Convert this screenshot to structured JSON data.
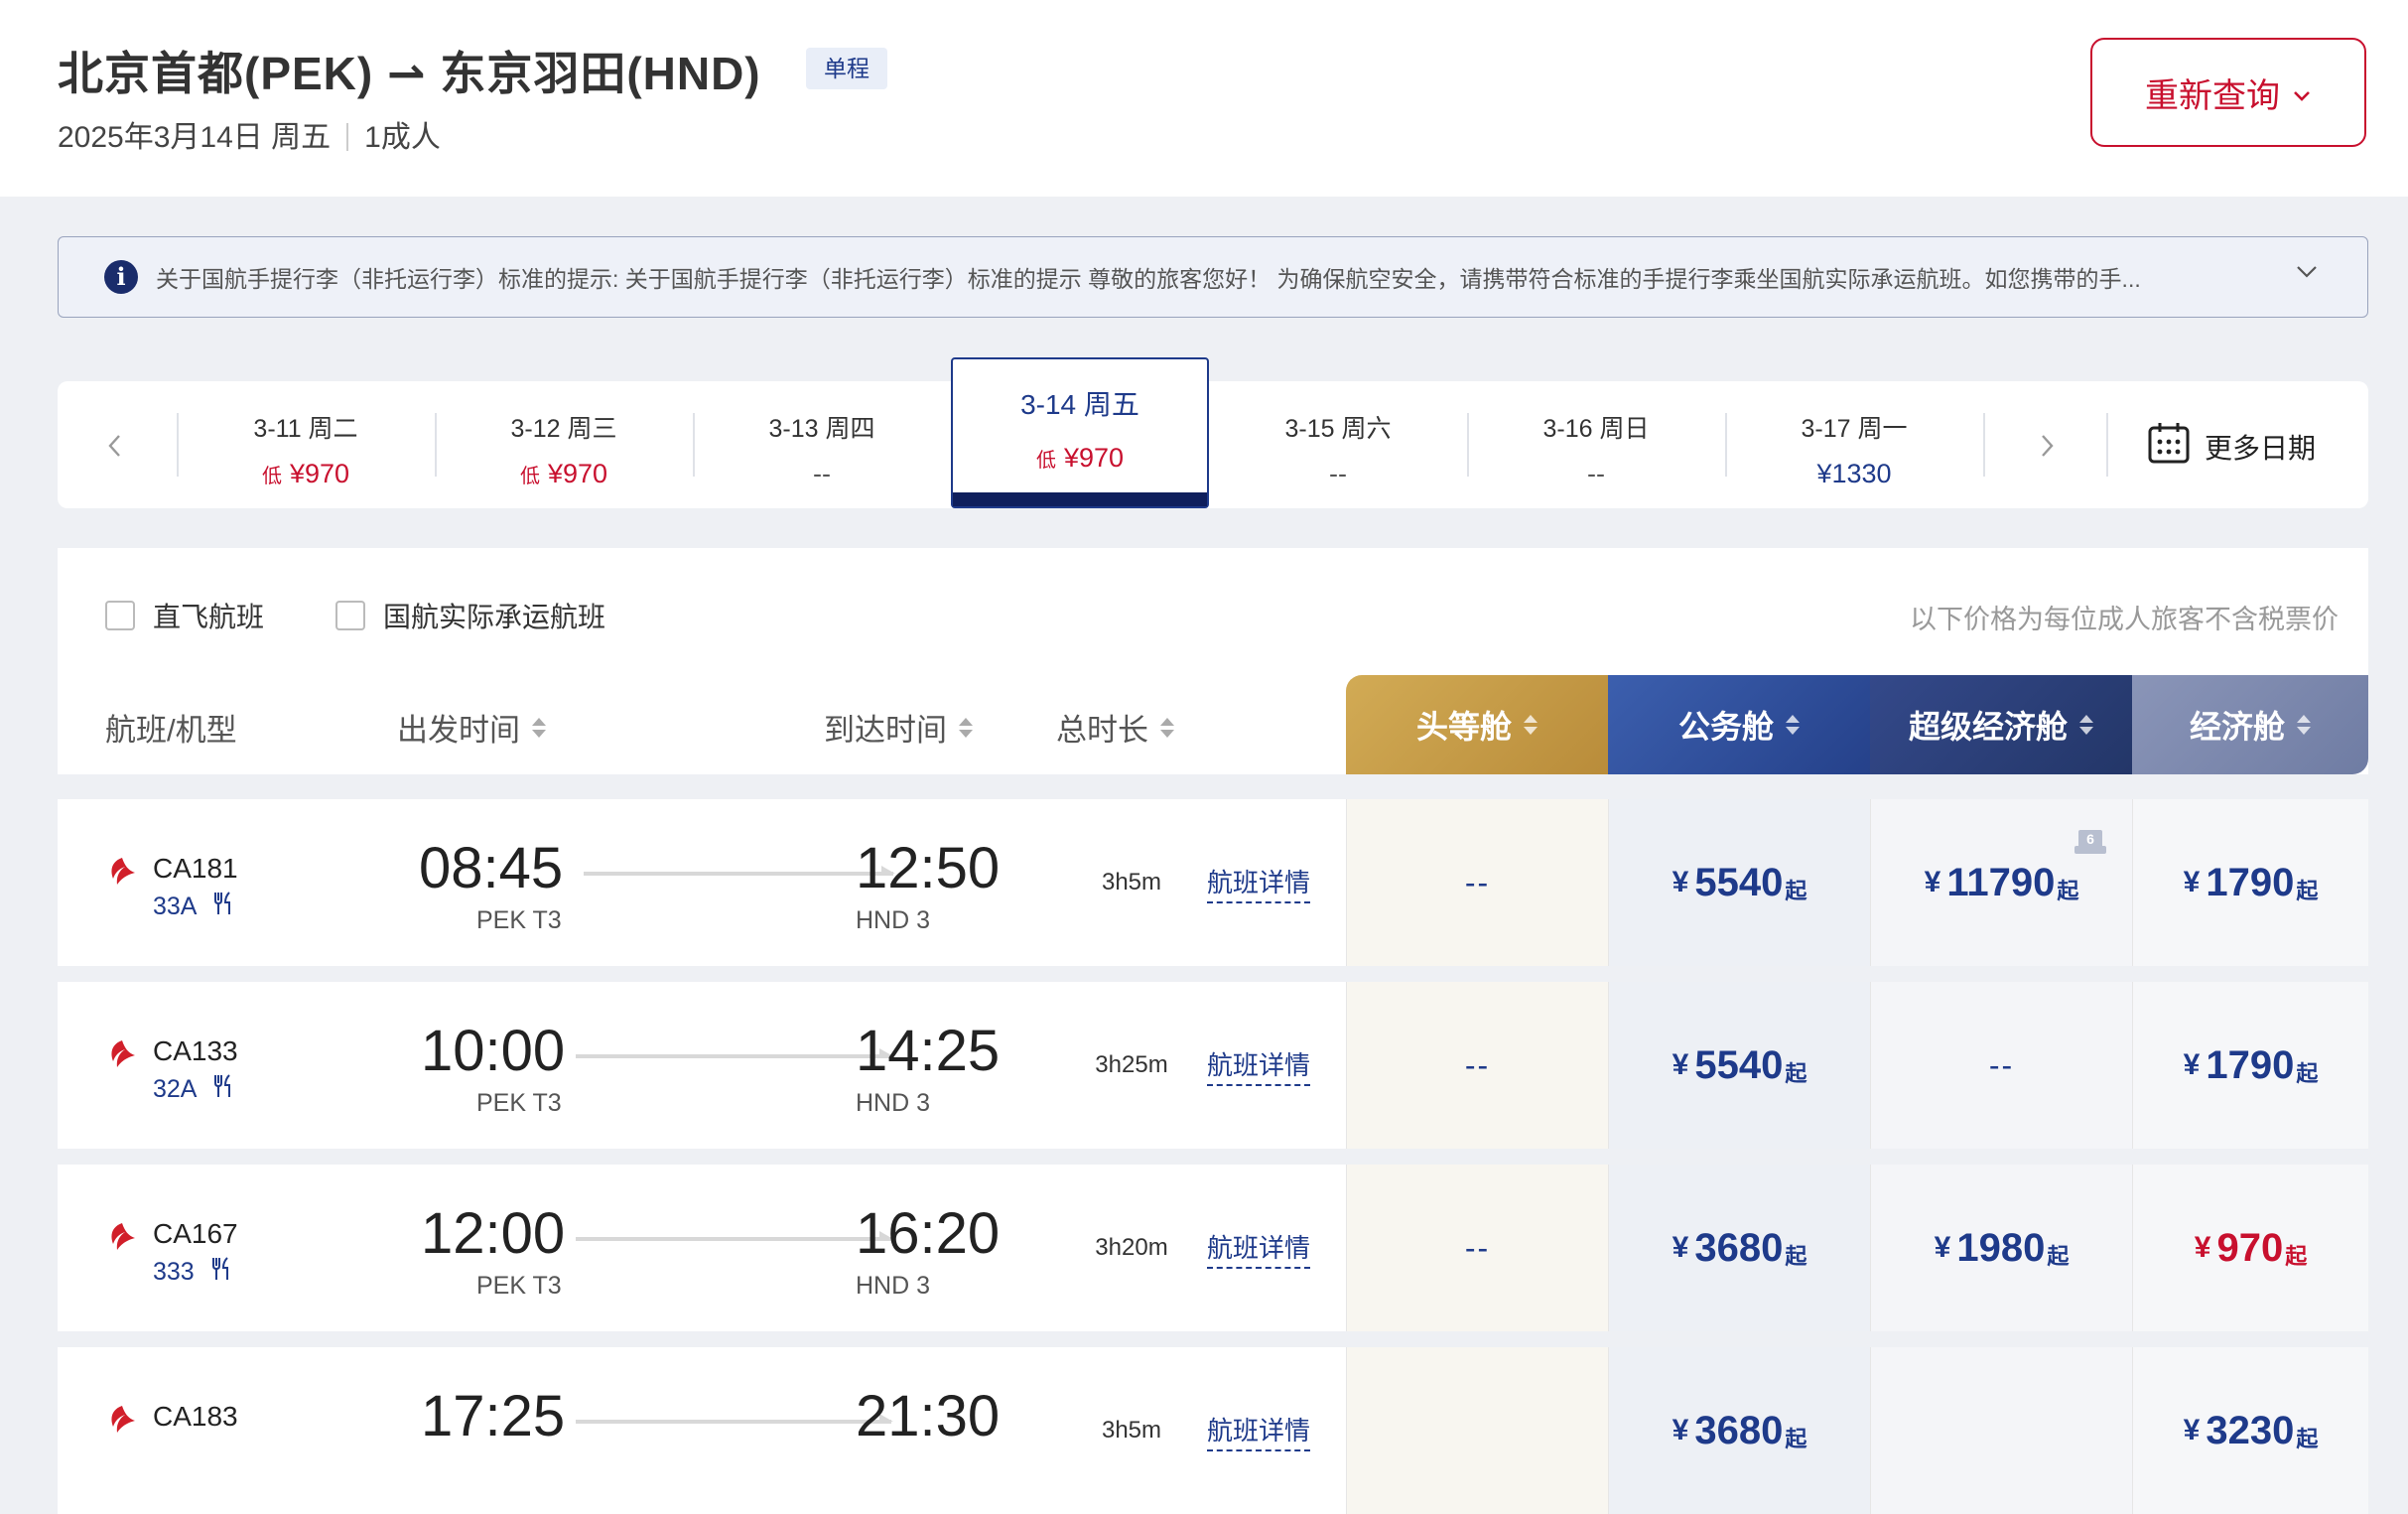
{
  "header": {
    "route": "北京首都(PEK) ⇀ 东京羽田(HND)",
    "trip_type": "单程",
    "date": "2025年3月14日 周五",
    "passengers": "1成人",
    "requery_label": "重新查询"
  },
  "notice": {
    "text": "关于国航手提行李（非托运行李）标准的提示:  关于国航手提行李（非托运行李）标准的提示 尊敬的旅客您好！ 为确保航空安全，请携带符合标准的手提行李乘坐国航实际承运航班。如您携带的手..."
  },
  "date_bar": {
    "dates": [
      {
        "label": "3-11 周二",
        "low": "低",
        "price": "¥970"
      },
      {
        "label": "3-12 周三",
        "low": "低",
        "price": "¥970"
      },
      {
        "label": "3-13 周四",
        "low": "",
        "price": "--"
      },
      {
        "label": "3-14 周五",
        "low": "低",
        "price": "¥970"
      },
      {
        "label": "3-15 周六",
        "low": "",
        "price": "--"
      },
      {
        "label": "3-16 周日",
        "low": "",
        "price": "--"
      },
      {
        "label": "3-17 周一",
        "low": "",
        "price": "¥1330"
      }
    ],
    "more_label": "更多日期"
  },
  "filters": {
    "nonstop": "直飞航班",
    "operated": "国航实际承运航班",
    "price_note": "以下价格为每位成人旅客不含税票价"
  },
  "columns": {
    "flight": "航班/机型",
    "depart": "出发时间",
    "arrive": "到达时间",
    "duration": "总时长",
    "first": "头等舱",
    "business": "公务舱",
    "premium": "超级经济舱",
    "economy": "经济舱"
  },
  "colors": {
    "brand_red": "#c8102e",
    "navy": "#1e3a8a",
    "first_gold": "#c9a14d",
    "business_blue": "#2f4e9a",
    "premium_navy": "#2a3f78",
    "economy_slate": "#7f8bae"
  },
  "flights": [
    {
      "no": "CA181",
      "craft": "33A",
      "dep": "08:45",
      "dep_apt": "PEK T3",
      "arr": "12:50",
      "arr_apt": "HND 3",
      "dur": "3h5m",
      "detail": "航班详情",
      "first": "--",
      "biz_cur": "¥",
      "biz": "5540",
      "biz_qi": "起",
      "sup_cur": "¥",
      "sup": "11790",
      "sup_qi": "起",
      "seats": "6",
      "eco_cur": "¥",
      "eco": "1790",
      "eco_qi": "起"
    },
    {
      "no": "CA133",
      "craft": "32A",
      "dep": "10:00",
      "dep_apt": "PEK T3",
      "arr": "14:25",
      "arr_apt": "HND 3",
      "dur": "3h25m",
      "detail": "航班详情",
      "first": "--",
      "biz_cur": "¥",
      "biz": "5540",
      "biz_qi": "起",
      "sup": "--",
      "eco_cur": "¥",
      "eco": "1790",
      "eco_qi": "起"
    },
    {
      "no": "CA167",
      "craft": "333",
      "dep": "12:00",
      "dep_apt": "PEK T3",
      "arr": "16:20",
      "arr_apt": "HND 3",
      "dur": "3h20m",
      "detail": "航班详情",
      "first": "--",
      "biz_cur": "¥",
      "biz": "3680",
      "biz_qi": "起",
      "sup_cur": "¥",
      "sup": "1980",
      "sup_qi": "起",
      "eco_cur": "¥",
      "eco": "970",
      "eco_qi": "起"
    },
    {
      "no": "CA183",
      "craft": "",
      "dep": "17:25",
      "dep_apt": "",
      "arr": "21:30",
      "arr_apt": "",
      "dur": "3h5m",
      "detail": "航班详情",
      "first": "",
      "biz_cur": "¥",
      "biz": "3680",
      "biz_qi": "起",
      "sup": "",
      "eco_cur": "¥",
      "eco": "3230",
      "eco_qi": "起"
    }
  ]
}
